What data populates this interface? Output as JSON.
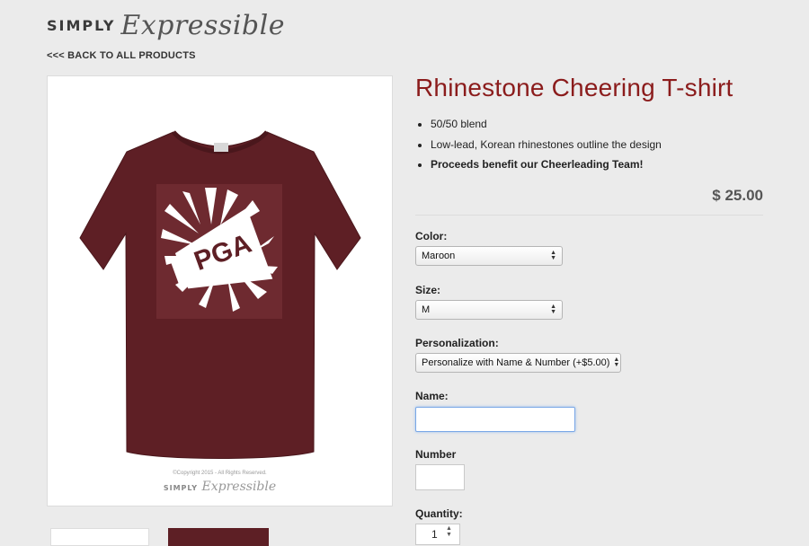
{
  "brand": {
    "simply": "SIMPLY",
    "expressible": "Expressible"
  },
  "nav": {
    "back_link": "<<< BACK TO ALL PRODUCTS"
  },
  "product_image": {
    "shirt_text": "PGA",
    "copyright": "©Copyright 2015 - All Rights Reserved.",
    "watermark_simply": "SIMPLY",
    "watermark_expressible": "Expressible",
    "shirt_color": "#5e1f25"
  },
  "product": {
    "title": "Rhinestone Cheering T-shirt",
    "features": [
      "50/50 blend",
      "Low-lead, Korean rhinestones outline the design",
      "Proceeds benefit our Cheerleading Team!"
    ],
    "price": "$ 25.00"
  },
  "options": {
    "color": {
      "label": "Color:",
      "value": "Maroon"
    },
    "size": {
      "label": "Size:",
      "value": "M"
    },
    "personalization": {
      "label": "Personalization:",
      "value": "Personalize with Name & Number (+$5.00)"
    },
    "name": {
      "label": "Name:",
      "value": ""
    },
    "number": {
      "label": "Number",
      "value": ""
    },
    "quantity": {
      "label": "Quantity:",
      "value": "1"
    }
  },
  "colors": {
    "title": "#8b1c1c",
    "shirt": "#5e1f25",
    "focus": "#7aa7e6"
  },
  "icons": {
    "select_arrows": "updown-arrows-icon",
    "spinner": "spinner-icon"
  }
}
